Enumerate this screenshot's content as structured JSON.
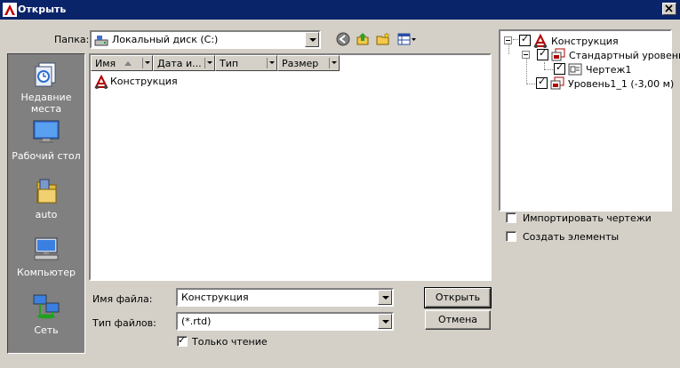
{
  "window": {
    "title": "Открыть"
  },
  "toolbar": {
    "folder_label": "Папка:",
    "folder_value": "Локальный диск (C:)"
  },
  "places": [
    {
      "label": "Недавние места",
      "icon": "recent-places-icon"
    },
    {
      "label": "Рабочий стол",
      "icon": "desktop-icon"
    },
    {
      "label": "auto",
      "icon": "user-folder-icon"
    },
    {
      "label": "Компьютер",
      "icon": "computer-icon"
    },
    {
      "label": "Сеть",
      "icon": "network-icon"
    }
  ],
  "filelist": {
    "columns": [
      "Имя",
      "Дата и...",
      "Тип",
      "Размер"
    ],
    "items": [
      {
        "name": "Конструкция",
        "icon": "structure-file-icon"
      }
    ]
  },
  "form": {
    "filename_label": "Имя файла:",
    "filename_value": "Конструкция",
    "filetype_label": "Тип файлов:",
    "filetype_value": "(*.rtd)",
    "readonly_label": "Только чтение",
    "readonly_checked": true,
    "open_label": "Открыть",
    "cancel_label": "Отмена"
  },
  "tree": {
    "root": "Конструкция",
    "level1": "Стандартный уровень",
    "drawing": "Чертеж1",
    "level2": "Уровень1_1 (-3,00 м)"
  },
  "options": {
    "import_drawings": "Импортировать чертежи",
    "create_elements": "Создать элементы"
  },
  "colors": {
    "titlebar": "#0a246a",
    "dialog": "#d4d0c8",
    "places_bg": "#808080"
  }
}
